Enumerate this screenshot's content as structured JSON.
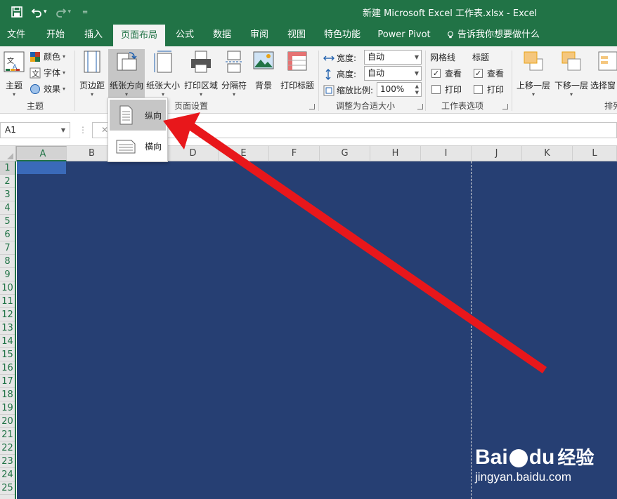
{
  "titlebar": {
    "title": "新建 Microsoft Excel 工作表.xlsx  -  Excel",
    "save_icon": "save-icon",
    "undo_icon": "undo-icon",
    "redo_icon": "redo-icon",
    "customize_icon": "customize-qat-icon"
  },
  "tabs": [
    "文件",
    "开始",
    "插入",
    "页面布局",
    "公式",
    "数据",
    "审阅",
    "视图",
    "特色功能",
    "Power Pivot",
    "告诉我你想要做什么"
  ],
  "active_tab": "页面布局",
  "ribbon": {
    "theme_group": {
      "theme": "主题",
      "colors": "颜色",
      "fonts": "字体",
      "effects": "效果",
      "label": "主题"
    },
    "page_setup": {
      "margins": "页边距",
      "orientation": "纸张方向",
      "size": "纸张大小",
      "print_area": "打印区域",
      "breaks": "分隔符",
      "background": "背景",
      "print_titles": "打印标题",
      "label": "页面设置"
    },
    "scale": {
      "width_label": "宽度:",
      "width_value": "自动",
      "height_label": "高度:",
      "height_value": "自动",
      "scale_label": "缩放比例:",
      "scale_value": "100%",
      "label": "调整为合适大小"
    },
    "sheet_options": {
      "gridlines": "网格线",
      "headings": "标题",
      "view": "查看",
      "print": "打印",
      "label": "工作表选项"
    },
    "arrange": {
      "bring_forward": "上移一层",
      "send_backward": "下移一层",
      "selection_pane": "选择窗",
      "label": "排列"
    }
  },
  "formula_bar": {
    "name_box": "A1",
    "cancel": "✕",
    "dots": "⋮"
  },
  "columns": [
    "A",
    "B",
    "C",
    "D",
    "E",
    "F",
    "G",
    "H",
    "I",
    "J",
    "K",
    "L"
  ],
  "rows": [
    "1",
    "2",
    "3",
    "4",
    "5",
    "6",
    "7",
    "8",
    "9",
    "10",
    "11",
    "12",
    "13",
    "14",
    "15",
    "16",
    "17",
    "18",
    "19",
    "20",
    "21",
    "22",
    "23",
    "24",
    "25"
  ],
  "orientation_menu": {
    "portrait": "纵向",
    "landscape": "横向"
  },
  "watermark": {
    "brand": "Bai",
    "brand2": "du",
    "product": "经验",
    "url": "jingyan.baidu.com"
  },
  "colors": {
    "excel_green": "#217346",
    "sheet_fill": "#263f73",
    "arrow_red": "#e8171b"
  }
}
